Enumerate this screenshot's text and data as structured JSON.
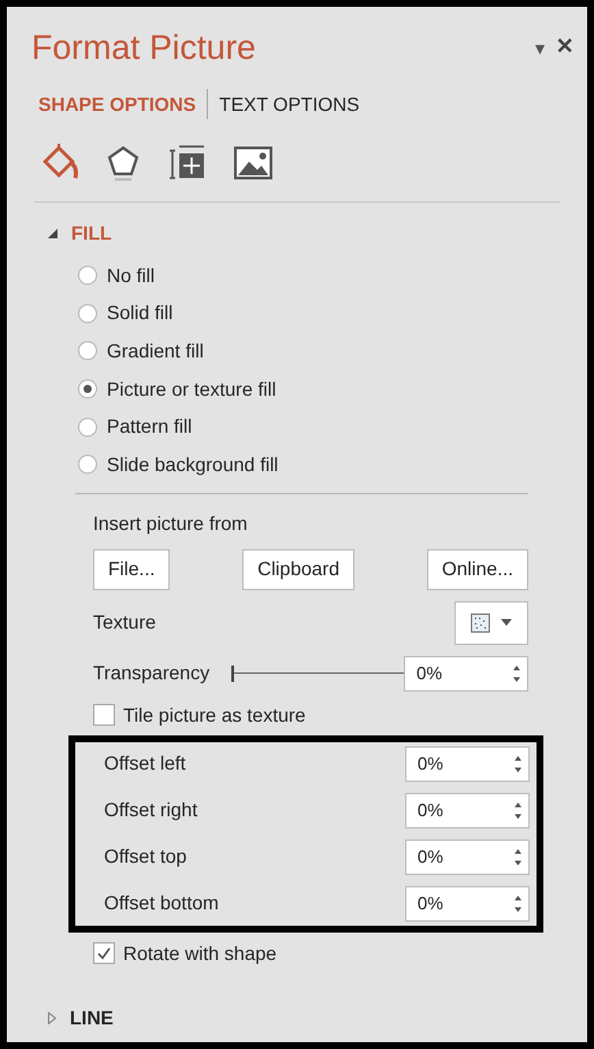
{
  "pane": {
    "title": "Format Picture",
    "menu_arrow": "▾",
    "close": "✕"
  },
  "tabs": [
    {
      "label": "SHAPE OPTIONS",
      "selected": true
    },
    {
      "label": "TEXT OPTIONS",
      "selected": false
    }
  ],
  "category_icons": [
    {
      "kind": "fill",
      "selected": true
    },
    {
      "kind": "effects",
      "selected": false
    },
    {
      "kind": "size",
      "selected": false
    },
    {
      "kind": "picture",
      "selected": false
    }
  ],
  "fill_section": {
    "title": "FILL",
    "expanded": true,
    "options": [
      {
        "label": "No fill",
        "selected": false
      },
      {
        "label": "Solid fill",
        "selected": false
      },
      {
        "label": "Gradient fill",
        "selected": false
      },
      {
        "label": "Picture or texture fill",
        "selected": true
      },
      {
        "label": "Pattern fill",
        "selected": false
      },
      {
        "label": "Slide background fill",
        "selected": false
      }
    ],
    "insert_label": "Insert picture from",
    "insert_buttons": [
      "File...",
      "Clipboard",
      "Online..."
    ],
    "texture_label": "Texture",
    "transparency": {
      "label": "Transparency",
      "level": 0,
      "value": "0%"
    },
    "tile": {
      "label": "Tile picture as texture",
      "checked": false
    },
    "offsets": {
      "highlighted": true,
      "rows": [
        {
          "label": "Offset left",
          "value": "0%"
        },
        {
          "label": "Offset right",
          "value": "0%"
        },
        {
          "label": "Offset top",
          "value": "0%"
        },
        {
          "label": "Offset bottom",
          "value": "0%"
        }
      ]
    },
    "rotate": {
      "label": "Rotate with shape",
      "checked": true
    }
  },
  "line_section": {
    "title": "LINE",
    "expanded": false
  }
}
